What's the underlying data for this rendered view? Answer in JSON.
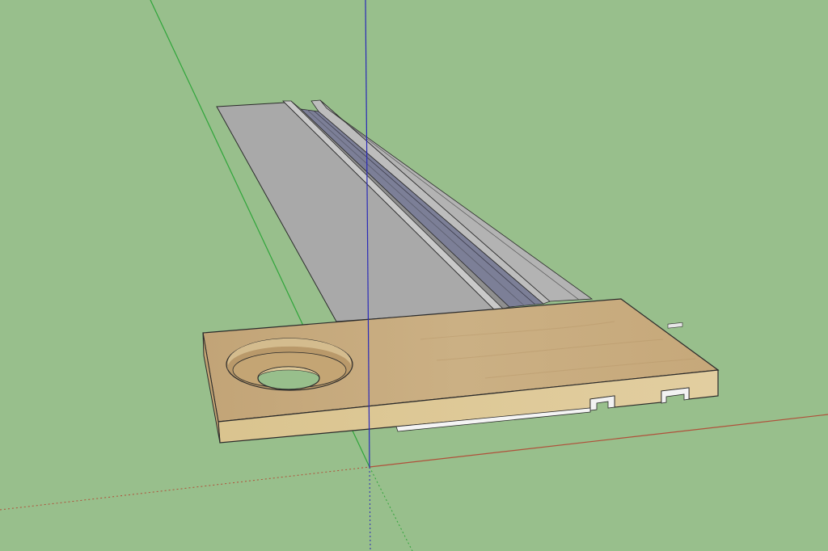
{
  "viewport": {
    "background_color": "#98bf8c"
  },
  "axes": {
    "red_axis_color": "#b0503a",
    "green_axis_color": "#2fa53a",
    "blue_axis_color": "#2a2ab8"
  },
  "model": {
    "rail_top_color": "#a9a9a9",
    "rail_edge_color": "#c7c7c7",
    "rail_channel_color": "#7c7f97",
    "board_top_color": "#c8ab7c",
    "board_edge_color": "#dcc696",
    "hole_inner_color": "#b29460",
    "outline_color": "#2a2a2a",
    "slot_color": "#f2f2f2"
  }
}
